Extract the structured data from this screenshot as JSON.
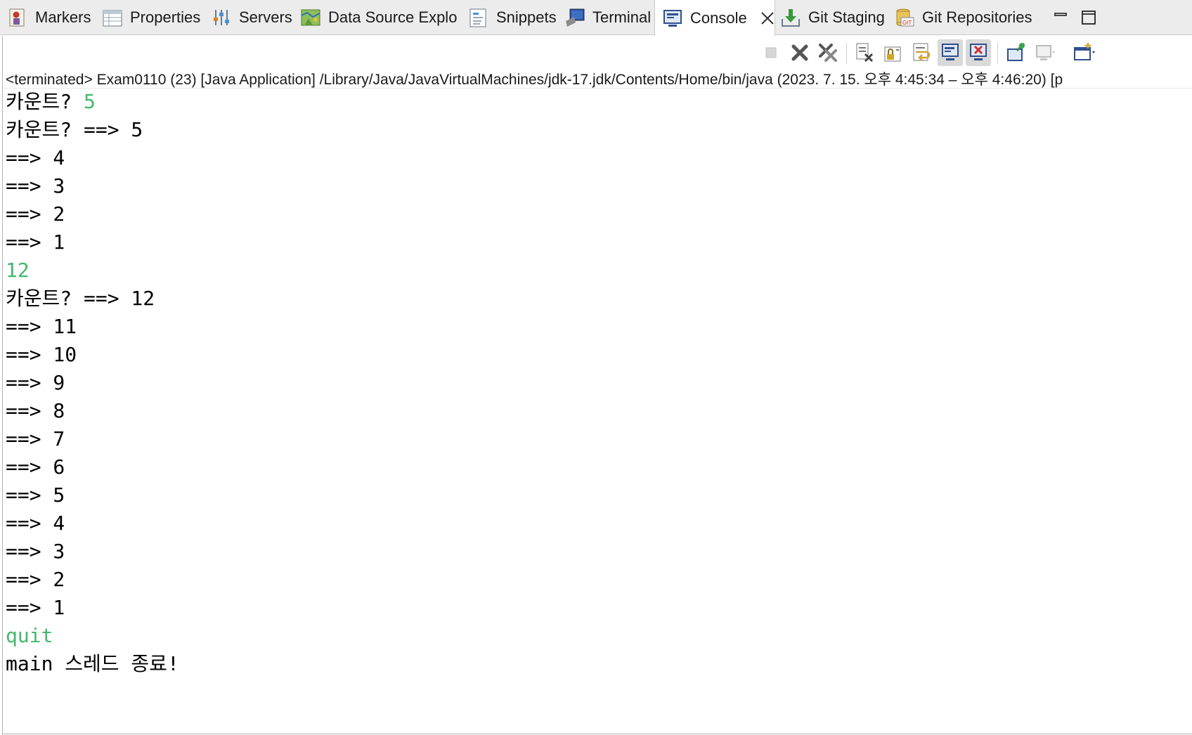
{
  "tabs": [
    {
      "id": "markers",
      "label": "Markers",
      "icon": "markers-icon"
    },
    {
      "id": "properties",
      "label": "Properties",
      "icon": "properties-icon"
    },
    {
      "id": "servers",
      "label": "Servers",
      "icon": "servers-icon"
    },
    {
      "id": "datasource",
      "label": "Data Source Explo",
      "icon": "data-source-explorer-icon"
    },
    {
      "id": "snippets",
      "label": "Snippets",
      "icon": "snippets-icon"
    },
    {
      "id": "terminal",
      "label": "Terminal",
      "icon": "terminal-icon"
    },
    {
      "id": "console",
      "label": "Console",
      "icon": "console-icon",
      "active": true
    },
    {
      "id": "gitstaging",
      "label": "Git Staging",
      "icon": "git-staging-icon"
    },
    {
      "id": "gitrepos",
      "label": "Git Repositories",
      "icon": "git-repositories-icon"
    }
  ],
  "header": {
    "text": "<terminated> Exam0110 (23) [Java Application] /Library/Java/JavaVirtualMachines/jdk-17.jdk/Contents/Home/bin/java  (2023. 7. 15. 오후 4:45:34 – 오후 4:46:20) [p"
  },
  "console": {
    "lines": [
      {
        "prompt": "카운트? ",
        "input": "5"
      },
      {
        "text": "카운트? ==> 5"
      },
      {
        "text": "==> 4"
      },
      {
        "text": "==> 3"
      },
      {
        "text": "==> 2"
      },
      {
        "text": "==> 1"
      },
      {
        "input": "12"
      },
      {
        "text": "카운트? ==> 12"
      },
      {
        "text": "==> 11"
      },
      {
        "text": "==> 10"
      },
      {
        "text": "==> 9"
      },
      {
        "text": "==> 8"
      },
      {
        "text": "==> 7"
      },
      {
        "text": "==> 6"
      },
      {
        "text": "==> 5"
      },
      {
        "text": "==> 4"
      },
      {
        "text": "==> 3"
      },
      {
        "text": "==> 2"
      },
      {
        "text": "==> 1"
      },
      {
        "input": "quit"
      },
      {
        "text": "main 스레드 종료!"
      }
    ]
  },
  "colors": {
    "input_text": "#40b96a",
    "tab_bar": "#ececec",
    "accent_blue": "#2f6db5"
  }
}
